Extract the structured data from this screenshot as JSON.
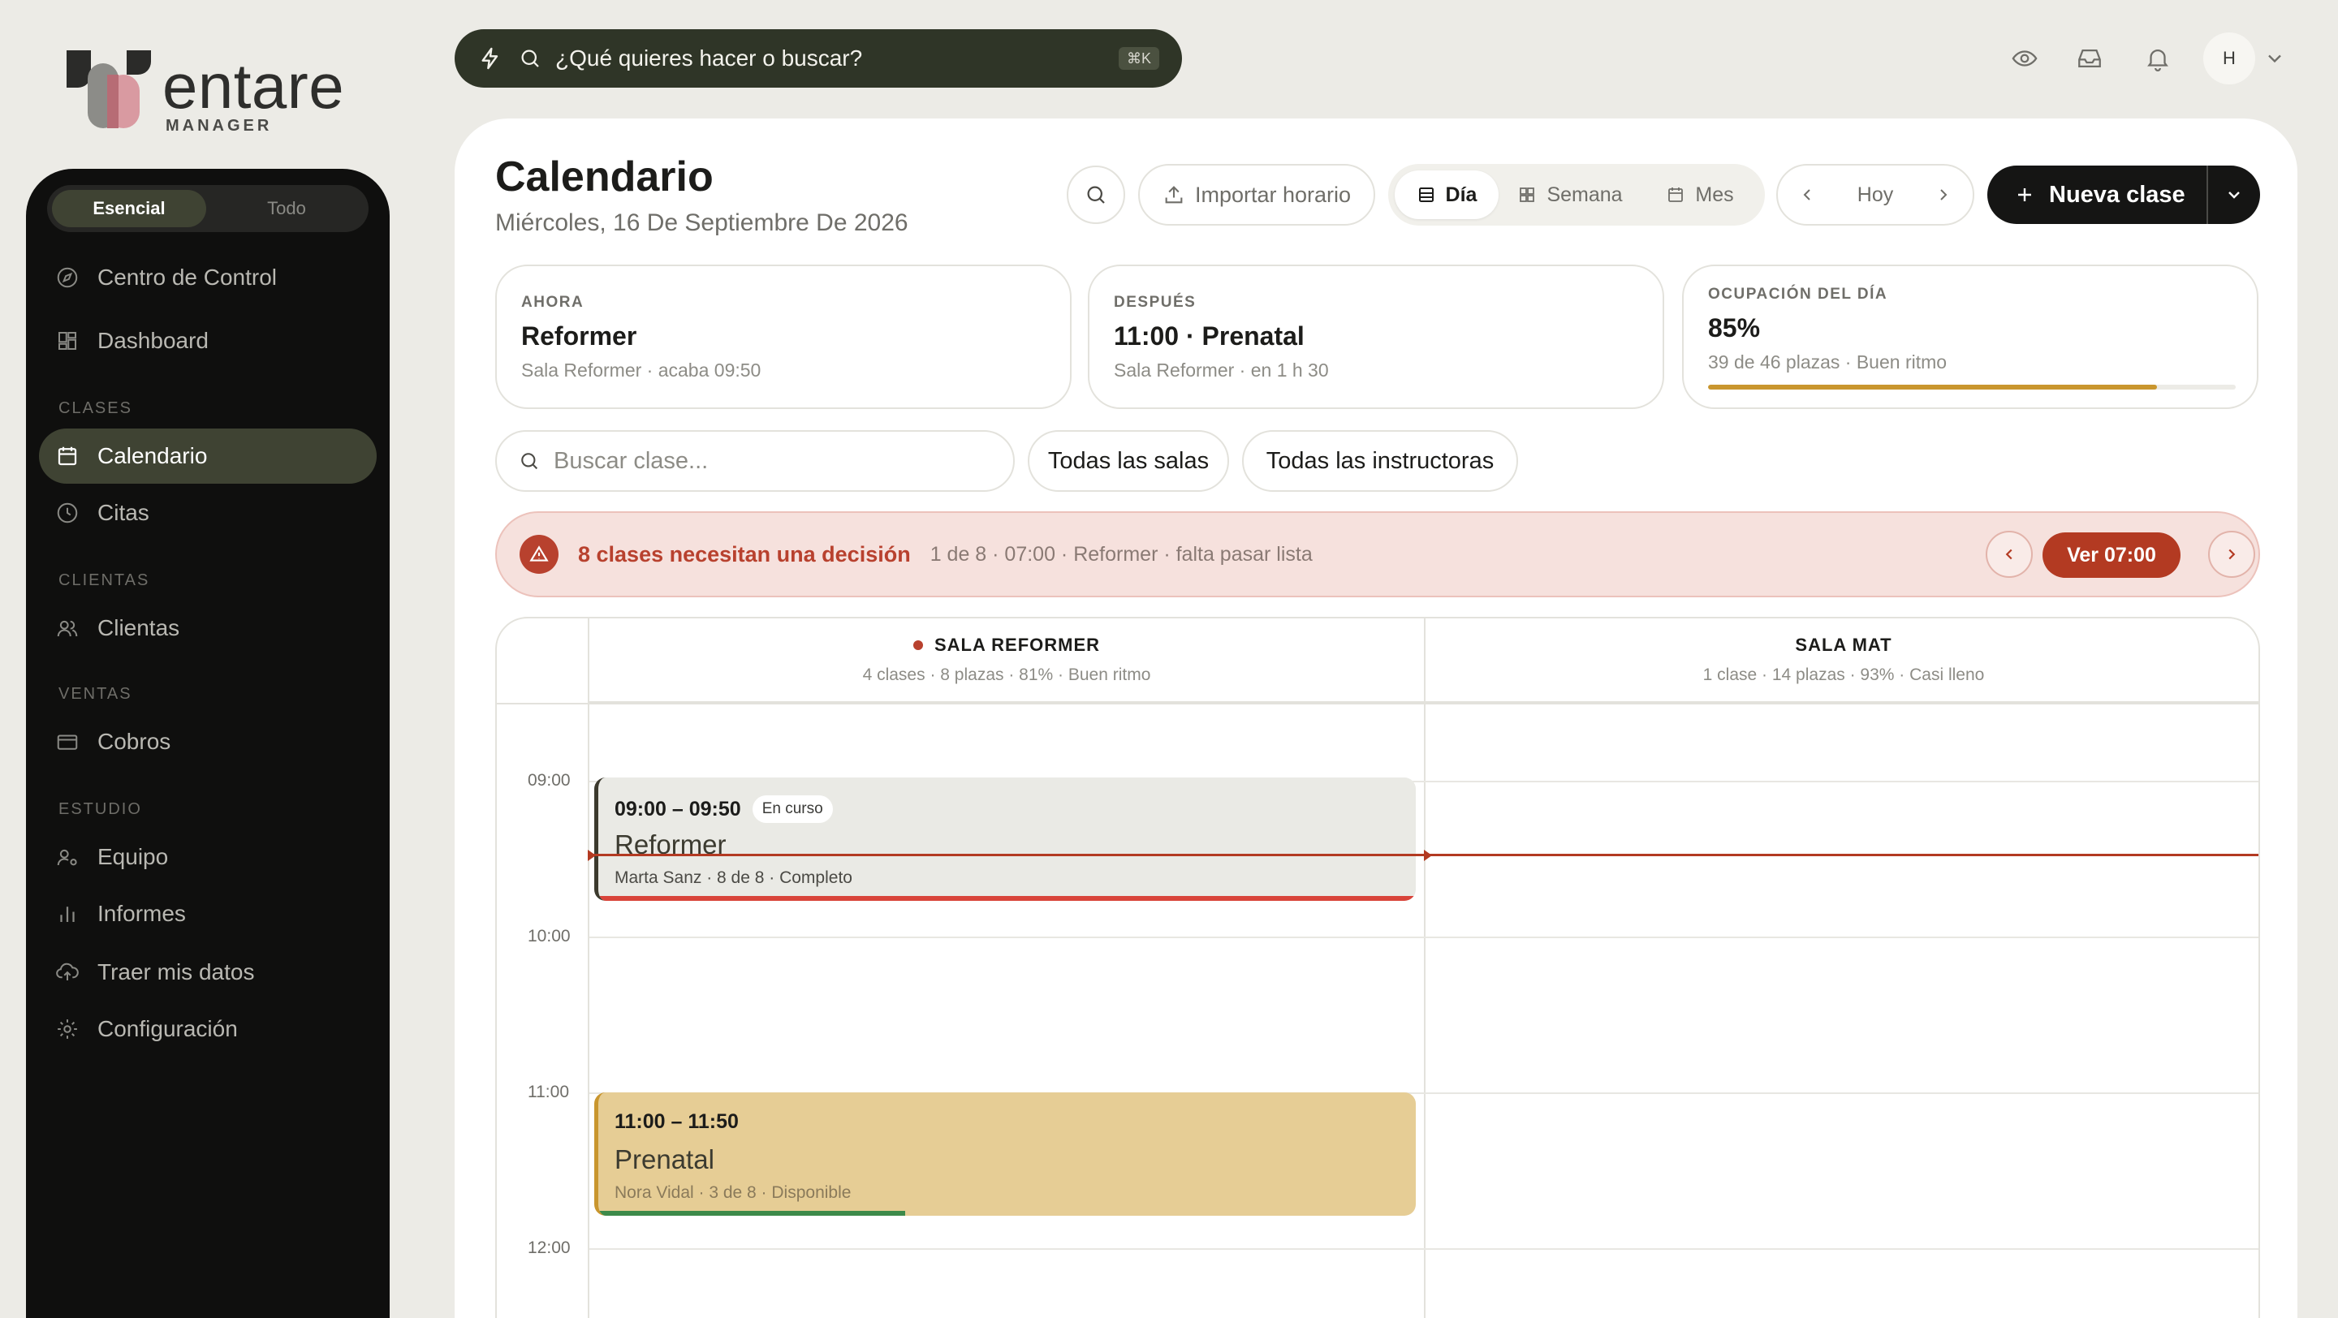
{
  "brand": {
    "name": "entare",
    "sub": "MANAGER"
  },
  "sidebar": {
    "mode_tabs": [
      "Esencial",
      "Todo"
    ],
    "items": [
      {
        "label": "Centro de Control",
        "icon": "compass-icon"
      },
      {
        "label": "Dashboard",
        "icon": "dashboard-icon"
      },
      {
        "label": "Calendario",
        "icon": "calendar-icon",
        "active": true
      },
      {
        "label": "Citas",
        "icon": "clock-icon"
      },
      {
        "label": "Clientas",
        "icon": "users-icon"
      },
      {
        "label": "Cobros",
        "icon": "credit-card-icon"
      },
      {
        "label": "Equipo",
        "icon": "team-icon"
      },
      {
        "label": "Informes",
        "icon": "bar-chart-icon"
      },
      {
        "label": "Traer mis datos",
        "icon": "cloud-upload-icon"
      },
      {
        "label": "Configuración",
        "icon": "gear-icon"
      }
    ],
    "sections": [
      "CLASES",
      "CLIENTAS",
      "VENTAS",
      "ESTUDIO"
    ]
  },
  "topbar": {
    "command_placeholder": "¿Qué quieres hacer o buscar?",
    "shortcut": "⌘K",
    "avatar_initial": "H"
  },
  "page": {
    "title": "Calendario",
    "date": "Miércoles, 16 De Septiembre De 2026",
    "import_label": "Importar horario",
    "views": [
      "Día",
      "Semana",
      "Mes"
    ],
    "active_view": "Día",
    "today_label": "Hoy",
    "new_class_label": "Nueva clase"
  },
  "cards": {
    "now": {
      "label": "AHORA",
      "value": "Reformer",
      "sub": "Sala Reformer · acaba 09:50"
    },
    "next": {
      "label": "DESPUÉS",
      "value": "11:00 · Prenatal",
      "sub": "Sala Reformer · en 1 h 30"
    },
    "occupancy": {
      "label": "OCUPACIÓN DEL DÍA",
      "value": "85%",
      "sub": "39 de 46 plazas · Buen ritmo",
      "progress": 0.85
    }
  },
  "filters": {
    "search_placeholder": "Buscar clase...",
    "rooms": "Todas las salas",
    "instructors": "Todas las instructoras"
  },
  "alert": {
    "title": "8 clases necesitan una decisión",
    "detail": "1 de 8 · 07:00 · Reformer · falta pasar lista",
    "cta": "Ver 07:00"
  },
  "calendar": {
    "rooms": [
      {
        "name": "SALA REFORMER",
        "meta": "4 clases · 8 plazas · 81% · Buen ritmo",
        "live": true
      },
      {
        "name": "SALA MAT",
        "meta": "1 clase · 14 plazas · 93% · Casi lleno"
      }
    ],
    "times": [
      "09:00",
      "10:00",
      "11:00",
      "12:00"
    ],
    "events": [
      {
        "time": "09:00 – 09:50",
        "badge": "En curso",
        "name": "Reformer",
        "info": "Marta Sanz · 8 de 8 · Completo",
        "fill": 1.0,
        "bar_color": "#d9443a"
      },
      {
        "time": "11:00 – 11:50",
        "name": "Prenatal",
        "info": "Nora Vidal · 3 de 8 · Disponible",
        "fill": 0.375,
        "bar_color": "#3d8a4a"
      }
    ]
  },
  "colors": {
    "accent_dark": "#3f4333",
    "alert_red": "#b33a22",
    "progress_gold": "#c9962e"
  }
}
